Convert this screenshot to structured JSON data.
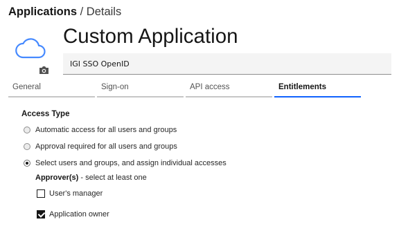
{
  "breadcrumb": {
    "root": "Applications",
    "separator": " / ",
    "current": "Details"
  },
  "app": {
    "icon": "cloud-icon",
    "photo_icon": "camera-icon",
    "title": "Custom Application",
    "description": "IGI SSO OpenID"
  },
  "tabs": [
    {
      "label": "General",
      "selected": false
    },
    {
      "label": "Sign-on",
      "selected": false
    },
    {
      "label": "API access",
      "selected": false
    },
    {
      "label": "Entitlements",
      "selected": true
    }
  ],
  "access": {
    "label": "Access Type",
    "options": [
      {
        "label": "Automatic access for all users and groups",
        "selected": false
      },
      {
        "label": "Approval required for all users and groups",
        "selected": false
      },
      {
        "label": "Select users and groups, and assign individual accesses",
        "selected": true
      }
    ],
    "approver_label": "Approver(s)",
    "approver_hint": " - select at least one",
    "approvers": [
      {
        "label": "User's manager",
        "checked": false
      },
      {
        "label": "Application owner",
        "checked": true
      }
    ]
  },
  "colors": {
    "accent": "#0f62fe",
    "icon": "#4589ff"
  }
}
